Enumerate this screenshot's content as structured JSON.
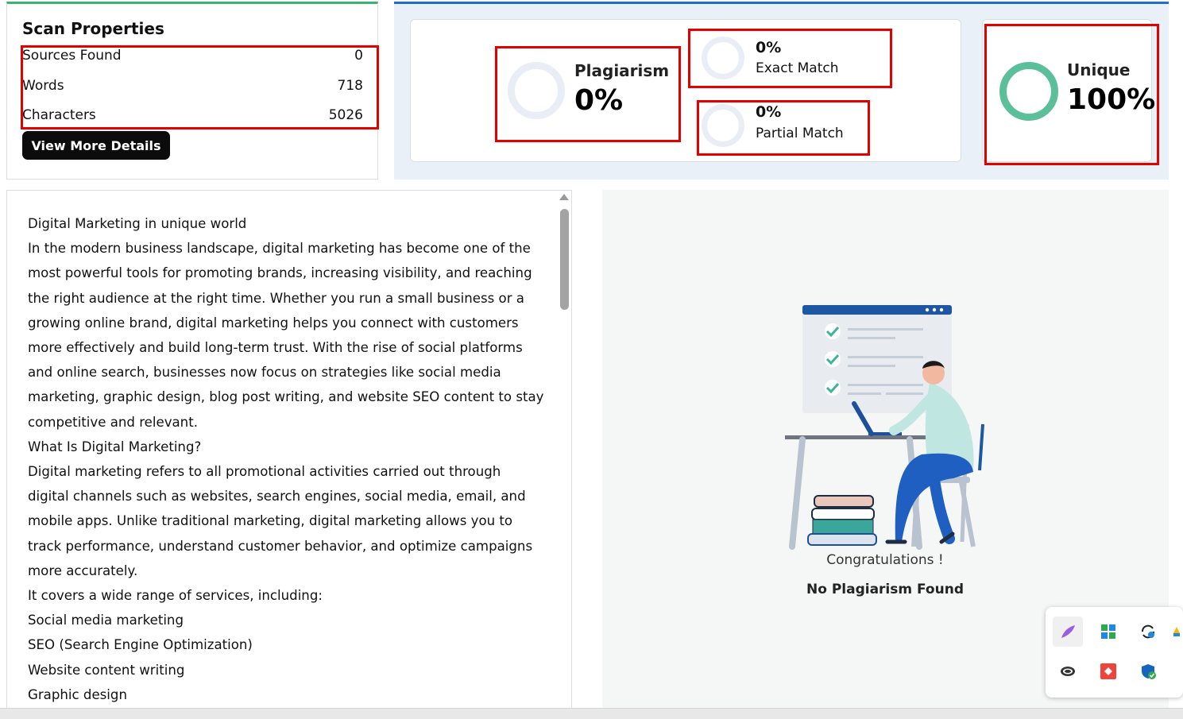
{
  "scan_properties": {
    "title": "Scan Properties",
    "rows": [
      {
        "label": "Sources Found",
        "value": "0"
      },
      {
        "label": "Words",
        "value": "718"
      },
      {
        "label": "Characters",
        "value": "5026"
      }
    ],
    "button_label": "View More Details"
  },
  "stats": {
    "plagiarism": {
      "label": "Plagiarism",
      "value": "0%"
    },
    "exact_match": {
      "value": "0%",
      "label": "Exact Match"
    },
    "partial_match": {
      "value": "0%",
      "label": "Partial Match"
    },
    "unique": {
      "label": "Unique",
      "value": "100%"
    }
  },
  "document": {
    "paragraphs": [
      "Digital Marketing in unique world",
      "In the modern business landscape, digital marketing has become one of the most powerful tools for promoting brands, increasing visibility, and reaching the right audience at the right time. Whether you run a small business or a growing online brand, digital marketing helps you connect with customers more effectively and build long-term trust. With the rise of social platforms and online search, businesses now focus on strategies like social media marketing, graphic design, blog post writing, and website SEO content to stay competitive and relevant.",
      "What Is Digital Marketing?",
      "Digital marketing refers to all promotional activities carried out through digital channels such as websites, search engines, social media, email, and mobile apps. Unlike traditional marketing, digital marketing allows you to track performance, understand customer behavior, and optimize campaigns more accurately.",
      "It covers a wide range of services, including:",
      "Social media marketing",
      "SEO (Search Engine Optimization)",
      "Website content writing",
      "Graphic design"
    ]
  },
  "result": {
    "congrats": "Congratulations !",
    "message": "No Plagiarism Found"
  },
  "colors": {
    "unique_ring": "#5bbf9a",
    "ring_empty": "#e9eef6",
    "highlight_box": "#e50000",
    "scan_top_border": "#3cb371",
    "stats_top_border": "#1e6fd0"
  },
  "tray_icons": [
    "feather-icon",
    "grid-app-icon",
    "sync-icon",
    "cloud-app-icon",
    "anydesk-icon",
    "security-shield-icon"
  ]
}
